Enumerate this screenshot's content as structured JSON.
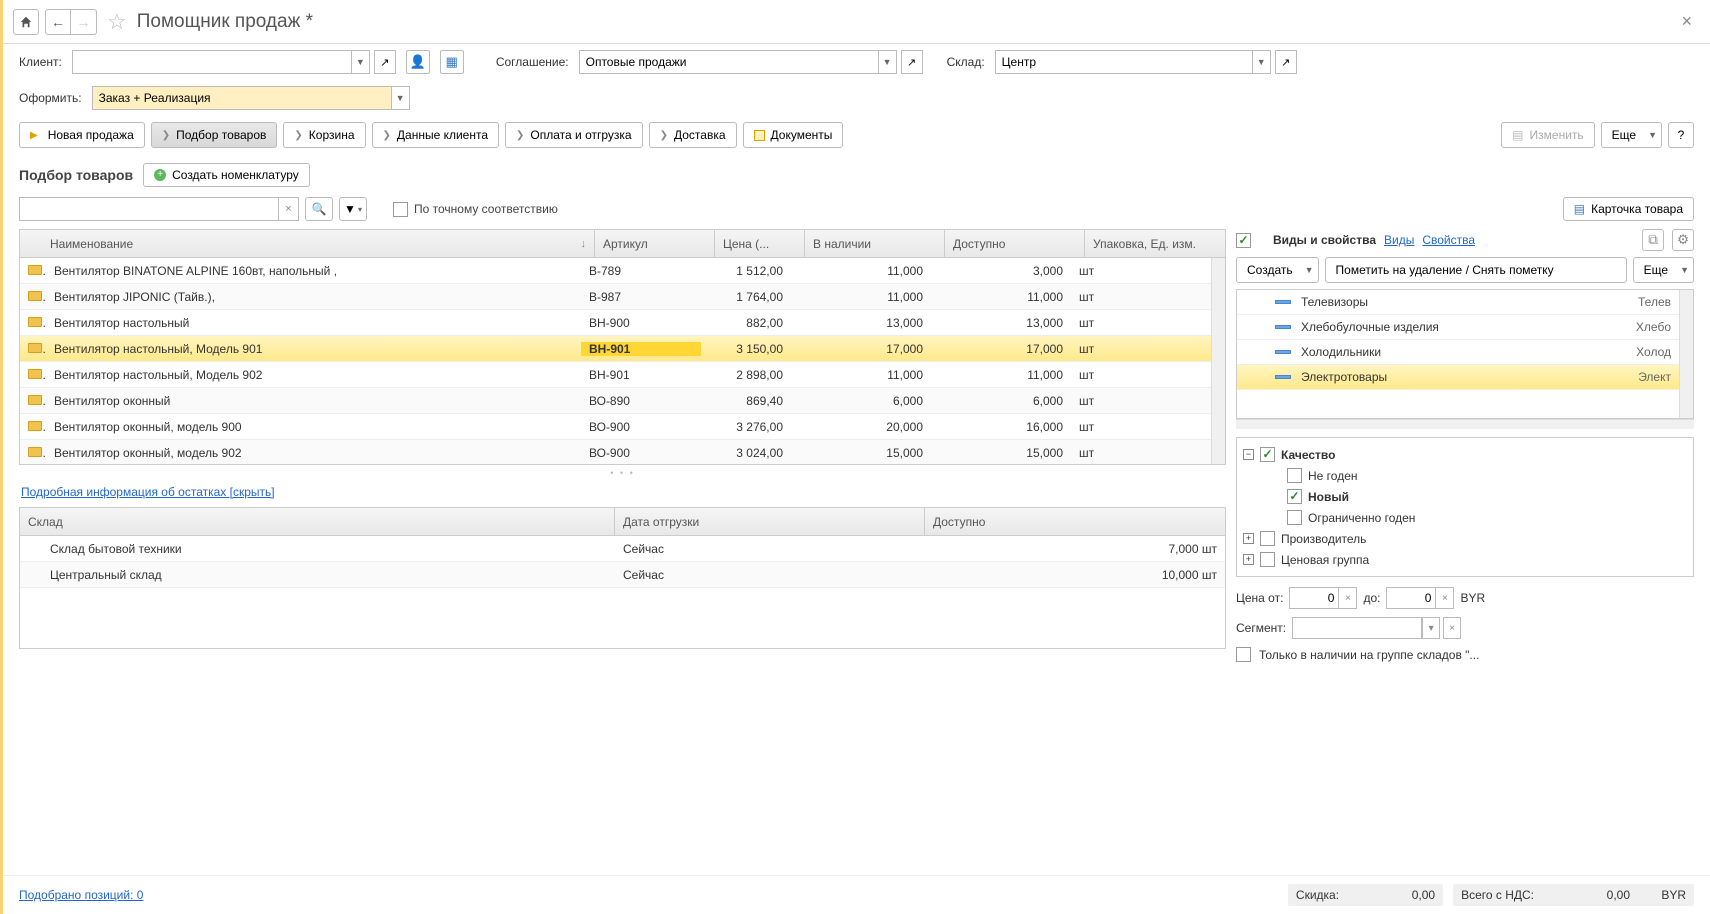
{
  "page_title": "Помощник продаж *",
  "fields": {
    "client_label": "Клиент:",
    "client_value": "",
    "agreement_label": "Соглашение:",
    "agreement_value": "Оптовые продажи",
    "warehouse_label": "Склад:",
    "warehouse_value": "Центр",
    "process_label": "Оформить:",
    "process_value": "Заказ + Реализация"
  },
  "toolbar": {
    "new_sale": "Новая продажа",
    "pick_goods": "Подбор товаров",
    "cart": "Корзина",
    "client_data": "Данные клиента",
    "payment": "Оплата и отгрузка",
    "delivery": "Доставка",
    "documents": "Документы",
    "edit": "Изменить",
    "more": "Еще",
    "help": "?"
  },
  "section": {
    "title": "Подбор товаров",
    "create": "Создать номенклатуру"
  },
  "filter": {
    "exact_match": "По точному соответствию",
    "product_card": "Карточка товара"
  },
  "grid": {
    "cols": {
      "name": "Наименование",
      "article": "Артикул",
      "price": "Цена (...",
      "stock": "В наличии",
      "available": "Доступно",
      "packaging": "Упаковка, Ед. изм."
    },
    "rows": [
      {
        "name": "Вентилятор BINATONE ALPINE 160вт, напольный  ,",
        "art": "В-789",
        "price": "1 512,00",
        "stock": "11,000",
        "avail": "3,000",
        "pack": "шт"
      },
      {
        "name": "Вентилятор JIPONIC (Тайв.),",
        "art": "В-987",
        "price": "1 764,00",
        "stock": "11,000",
        "avail": "11,000",
        "pack": "шт"
      },
      {
        "name": "Вентилятор настольный",
        "art": "ВН-900",
        "price": "882,00",
        "stock": "13,000",
        "avail": "13,000",
        "pack": "шт"
      },
      {
        "name": "Вентилятор настольный, Модель 901",
        "art": "ВН-901",
        "price": "3 150,00",
        "stock": "17,000",
        "avail": "17,000",
        "pack": "шт",
        "sel": true
      },
      {
        "name": "Вентилятор настольный, Модель 902",
        "art": "ВН-901",
        "price": "2 898,00",
        "stock": "11,000",
        "avail": "11,000",
        "pack": "шт"
      },
      {
        "name": "Вентилятор оконный",
        "art": "ВО-890",
        "price": "869,40",
        "stock": "6,000",
        "avail": "6,000",
        "pack": "шт"
      },
      {
        "name": "Вентилятор оконный, модель 900",
        "art": "ВО-900",
        "price": "3 276,00",
        "stock": "20,000",
        "avail": "16,000",
        "pack": "шт"
      },
      {
        "name": "Вентилятор оконный, модель 902",
        "art": "ВО-900",
        "price": "3 024,00",
        "stock": "15,000",
        "avail": "15,000",
        "pack": "шт"
      }
    ]
  },
  "detail_link": "Подробная информация об остатках [скрыть]",
  "stock": {
    "cols": {
      "wh": "Склад",
      "date": "Дата отгрузки",
      "avail": "Доступно"
    },
    "rows": [
      {
        "wh": "Склад бытовой техники",
        "date": "Сейчас",
        "avail": "7,000 шт"
      },
      {
        "wh": "Центральный склад",
        "date": "Сейчас",
        "avail": "10,000 шт"
      }
    ]
  },
  "right": {
    "types_props": "Виды и свойства",
    "types_link": "Виды",
    "props_link": "Свойства",
    "create": "Создать",
    "mark_delete": "Пометить на удаление / Снять пометку",
    "more": "Еще",
    "categories": [
      {
        "name": "Телевизоры",
        "short": "Телев"
      },
      {
        "name": "Хлебобулочные изделия",
        "short": "Хлебо"
      },
      {
        "name": "Холодильники",
        "short": "Холод"
      },
      {
        "name": "Электротовары",
        "short": "Элект",
        "sel": true
      }
    ],
    "props": {
      "quality": "Качество",
      "not_suitable": "Не годен",
      "new": "Новый",
      "limited": "Ограниченно годен",
      "manufacturer": "Производитель",
      "price_group": "Ценовая группа"
    },
    "price_from_lbl": "Цена от:",
    "price_to_lbl": "до:",
    "price_from": "0",
    "price_to": "0",
    "currency": "BYR",
    "segment_lbl": "Сегмент:",
    "only_stock": "Только в наличии на группе складов \"..."
  },
  "footer": {
    "picked": "Подобрано позиций: 0",
    "discount_lbl": "Скидка:",
    "discount_val": "0,00",
    "total_lbl": "Всего с НДС:",
    "total_val": "0,00",
    "currency": "BYR"
  }
}
